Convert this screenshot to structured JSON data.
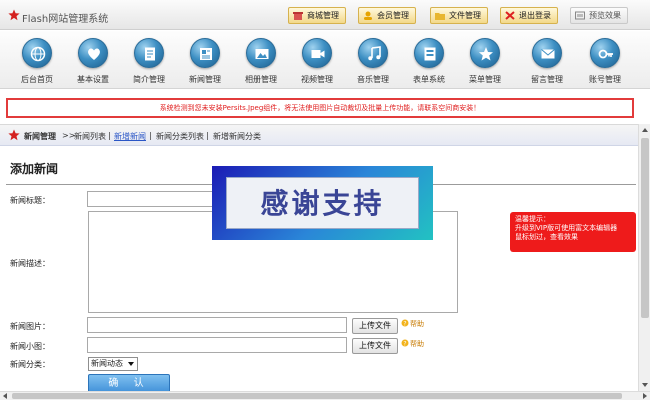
{
  "app": {
    "title": "Flash网站管理系统"
  },
  "topbar": {
    "buttons": [
      {
        "label": "商城管理",
        "icon": "shop-icon"
      },
      {
        "label": "会员管理",
        "icon": "member-icon"
      },
      {
        "label": "文件管理",
        "icon": "file-icon"
      },
      {
        "label": "退出登录",
        "icon": "logout-icon"
      },
      {
        "label": "预览效果",
        "icon": "preview-icon"
      }
    ]
  },
  "nav": {
    "items": [
      {
        "label": "后台首页",
        "icon": "globe-icon"
      },
      {
        "label": "基本设置",
        "icon": "heart-icon"
      },
      {
        "label": "简介管理",
        "icon": "document-icon"
      },
      {
        "label": "新闻管理",
        "icon": "news-icon"
      },
      {
        "label": "相册管理",
        "icon": "album-icon"
      },
      {
        "label": "视频管理",
        "icon": "video-icon"
      },
      {
        "label": "音乐管理",
        "icon": "music-icon"
      },
      {
        "label": "表单系统",
        "icon": "form-icon"
      },
      {
        "label": "菜单管理",
        "icon": "star-icon"
      },
      {
        "label": "留言管理",
        "icon": "mail-icon"
      },
      {
        "label": "账号管理",
        "icon": "key-icon"
      }
    ]
  },
  "warning": {
    "text": "系统检测到您未安装Persits.Jpeg组件，将无法使用图片自动裁切及批量上传功能，请联系空间商安装！"
  },
  "breadcrumb": {
    "current": "新闻管理",
    "separator": ">>",
    "links": [
      "新闻列表",
      "新增新闻",
      "新闻分类列表",
      "新增新闻分类"
    ],
    "divider": "|"
  },
  "form": {
    "title": "添加新闻",
    "labels": {
      "title": "新闻标题：",
      "description": "新闻描述：",
      "image": "新闻图片：",
      "thumb": "新闻小图：",
      "category": "新闻分类："
    },
    "values": {
      "title": "",
      "description": "",
      "image": "",
      "thumb": ""
    },
    "upload_label": "上传文件",
    "help_label": "帮助",
    "category_selected": "新闻动态",
    "submit_label": "确 认"
  },
  "tip": {
    "lines": [
      "温馨提示：",
      "升级到VIP版可使用富文本编辑器",
      "鼠标划过，查看效果"
    ]
  },
  "banner": {
    "text": "感谢支持"
  },
  "colors": {
    "warning": "#e23b3b",
    "tip": "#ee1b1b",
    "link": "#2a56c6",
    "submit": "#3f8fd8"
  }
}
